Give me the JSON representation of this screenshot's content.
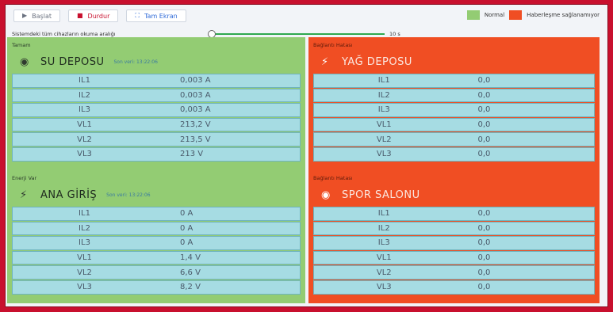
{
  "toolbar": {
    "start_label": "Başlat",
    "stop_label": "Durdur",
    "fullscreen_label": "Tam Ekran"
  },
  "legend": {
    "normal_label": "Normal",
    "no_comm_label": "Haberleşme sağlanamıyor",
    "normal_color": "#93cc73",
    "error_color": "#f04e23"
  },
  "slider": {
    "label": "Sistemdeki tüm cihazların okuma aralığı",
    "value": "10 s"
  },
  "panels": [
    {
      "status": "ok",
      "sub": "Tamam",
      "icon": "sensor-icon",
      "name": "SU DEPOSU",
      "timestamp": "Son veri: 13:22:06",
      "rows": [
        {
          "k": "IL1",
          "v": "0,003 A"
        },
        {
          "k": "IL2",
          "v": "0,003 A"
        },
        {
          "k": "IL3",
          "v": "0,003 A"
        },
        {
          "k": "VL1",
          "v": "213,2 V"
        },
        {
          "k": "VL2",
          "v": "213,5 V"
        },
        {
          "k": "VL3",
          "v": "213 V"
        }
      ]
    },
    {
      "status": "bad",
      "sub": "Bağlantı Hatası",
      "icon": "bolt-icon",
      "name": "YAĞ DEPOSU",
      "timestamp": "",
      "rows": [
        {
          "k": "IL1",
          "v": "0,0"
        },
        {
          "k": "IL2",
          "v": "0,0"
        },
        {
          "k": "IL3",
          "v": "0,0"
        },
        {
          "k": "VL1",
          "v": "0,0"
        },
        {
          "k": "VL2",
          "v": "0,0"
        },
        {
          "k": "VL3",
          "v": "0,0"
        }
      ]
    },
    {
      "status": "ok",
      "sub": "Enerji Var",
      "icon": "bolt-icon",
      "name": "ANA GİRİŞ",
      "timestamp": "Son veri: 13:22:06",
      "rows": [
        {
          "k": "IL1",
          "v": "0 A"
        },
        {
          "k": "IL2",
          "v": "0 A"
        },
        {
          "k": "IL3",
          "v": "0 A"
        },
        {
          "k": "VL1",
          "v": "1,4 V"
        },
        {
          "k": "VL2",
          "v": "6,6 V"
        },
        {
          "k": "VL3",
          "v": "8,2 V"
        }
      ]
    },
    {
      "status": "bad",
      "sub": "Bağlantı Hatası",
      "icon": "sensor-icon",
      "name": "SPOR SALONU",
      "timestamp": "",
      "rows": [
        {
          "k": "IL1",
          "v": "0,0"
        },
        {
          "k": "IL2",
          "v": "0,0"
        },
        {
          "k": "IL3",
          "v": "0,0"
        },
        {
          "k": "VL1",
          "v": "0,0"
        },
        {
          "k": "VL2",
          "v": "0,0"
        },
        {
          "k": "VL3",
          "v": "0,0"
        }
      ]
    }
  ]
}
